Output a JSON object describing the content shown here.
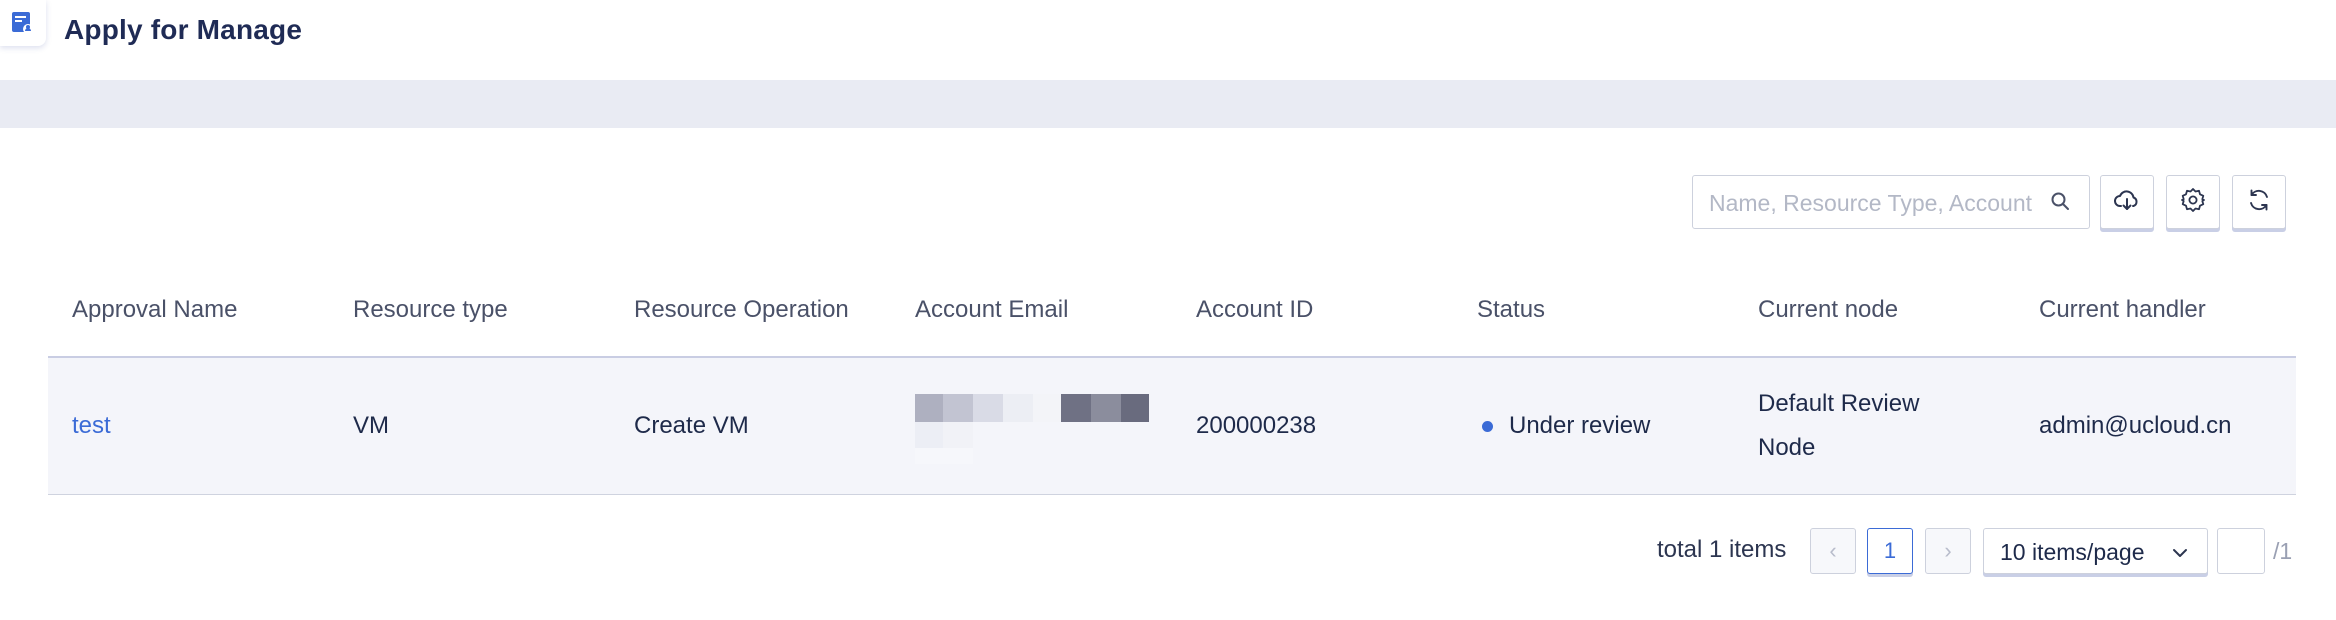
{
  "header": {
    "title": "Apply for Manage",
    "icon": "approval-doc-icon"
  },
  "toolbar": {
    "search_placeholder": "Name, Resource Type, Account",
    "buttons": [
      {
        "name": "download-button",
        "icon": "cloud-download-icon"
      },
      {
        "name": "settings-button",
        "icon": "gear-icon"
      },
      {
        "name": "refresh-button",
        "icon": "refresh-icon"
      }
    ]
  },
  "table": {
    "columns": [
      "Approval Name",
      "Resource type",
      "Resource Operation",
      "Account Email",
      "Account ID",
      "Status",
      "Current node",
      "Current handler"
    ],
    "rows": [
      {
        "approval_name": "test",
        "resource_type": "VM",
        "resource_operation": "Create VM",
        "account_email": "",
        "account_id": "200000238",
        "status": "Under review",
        "current_node_line1": "Default Review",
        "current_node_line2": "Node",
        "current_handler": "admin@ucloud.cn"
      }
    ]
  },
  "pagination": {
    "total_text": "total 1 items",
    "prev": "‹",
    "current_page": "1",
    "next": "›",
    "page_size": "10 items/page",
    "jump_value": "",
    "total_pages": "/1"
  },
  "colors": {
    "accent": "#3b6bd6",
    "header_title": "#1f2b55",
    "band": "#e9ebf3",
    "row_bg": "#f4f5fa"
  }
}
